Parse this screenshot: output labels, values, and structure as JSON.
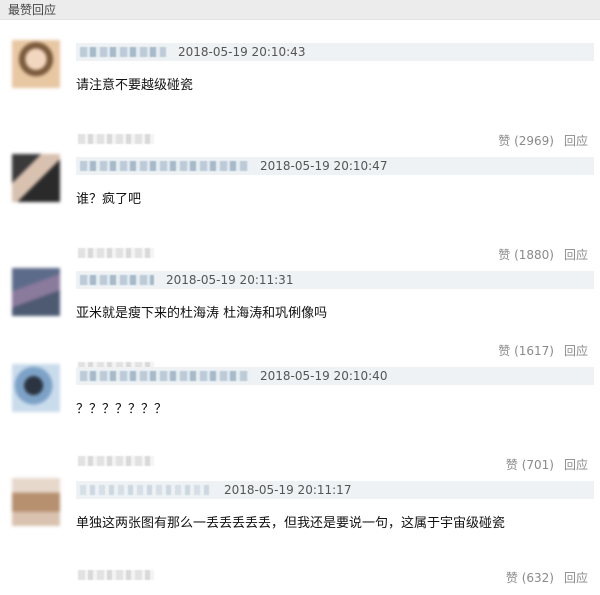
{
  "header": {
    "title": "最赞回应"
  },
  "comments": [
    {
      "timestamp": "2018-05-19 20:10:43",
      "content": "请注意不要越级碰瓷",
      "like_label": "赞 (2969)",
      "reply_label": "回应"
    },
    {
      "timestamp": "2018-05-19 20:10:47",
      "content": "谁？疯了吧",
      "like_label": "赞 (1880)",
      "reply_label": "回应"
    },
    {
      "timestamp": "2018-05-19 20:11:31",
      "content": "亚米就是瘦下来的杜海涛 杜海涛和巩俐像吗",
      "like_label": "赞 (1617)",
      "reply_label": "回应"
    },
    {
      "timestamp": "2018-05-19 20:10:40",
      "content": "？？？？？？？",
      "like_label": "赞 (701)",
      "reply_label": "回应"
    },
    {
      "timestamp": "2018-05-19 20:11:17",
      "content": "单独这两张图有那么一丢丢丢丢丢，但我还是要说一句，这属于宇宙级碰瓷",
      "like_label": "赞 (632)",
      "reply_label": "回应"
    }
  ],
  "colors": {
    "header_bg": "#ececec",
    "namebar_bg": "#eef2f4",
    "action_text": "#8a8a8a"
  },
  "icons": {
    "avatar": "user-avatar-image"
  }
}
